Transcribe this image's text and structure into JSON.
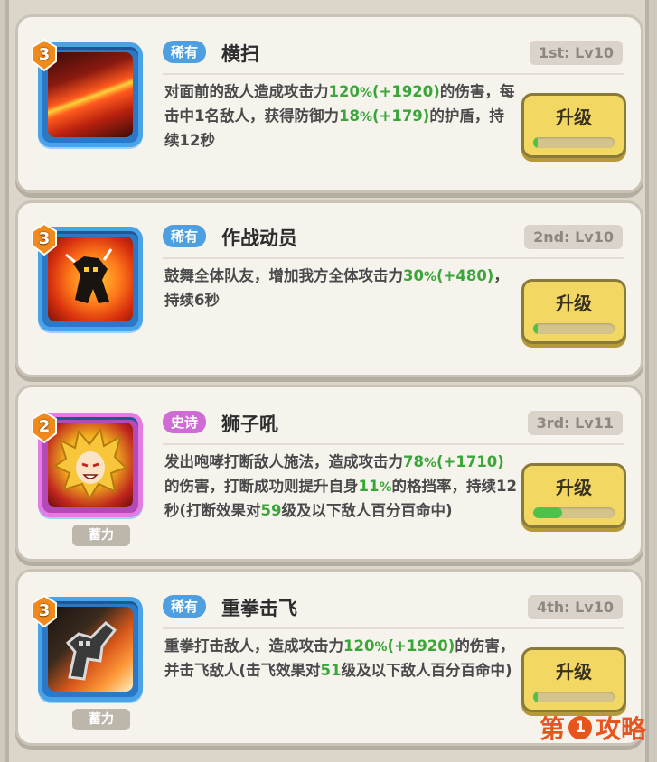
{
  "skills": [
    {
      "stars": "3",
      "rarity": "稀有",
      "name": "横扫",
      "level": "1st: Lv10",
      "desc": [
        "对面前的敌人造成攻击力",
        "120",
        "%",
        "(+1920)",
        "的伤害，每击中1名敌人，获得防御力",
        "18",
        "%",
        "(+179)",
        "的护盾，持续12秒"
      ],
      "upgrade": "升级",
      "progress": 0.05
    },
    {
      "stars": "3",
      "rarity": "稀有",
      "name": "作战动员",
      "level": "2nd: Lv10",
      "desc": [
        "鼓舞全体队友，增加我方全体攻击力",
        "30",
        "%",
        "(+480)",
        "，持续6秒"
      ],
      "upgrade": "升级",
      "progress": 0.05
    },
    {
      "stars": "2",
      "rarity": "史诗",
      "name": "狮子吼",
      "level": "3rd: Lv11",
      "desc": [
        "发出咆哮打断敌人施法，造成攻击力",
        "78",
        "%",
        "(+1710)",
        "的伤害，打断成功则提升自身",
        "11",
        "%",
        "的格挡率，持续12秒(打断效果对",
        "59",
        "级及以下敌人百分百命中)"
      ],
      "upgrade": "升级",
      "progress": 0.35,
      "charge": "蓄力"
    },
    {
      "stars": "3",
      "rarity": "稀有",
      "name": "重拳击飞",
      "level": "4th: Lv10",
      "desc": [
        "重拳打击敌人，造成攻击力",
        "120",
        "%",
        "(+1920)",
        "的伤害，并击飞敌人(击飞效果对",
        "51",
        "级及以下敌人百分百命中)"
      ],
      "upgrade": "升级",
      "progress": 0.05,
      "charge": "蓄力"
    }
  ],
  "watermark": {
    "pre": "第",
    "num": "1",
    "post": "攻略"
  },
  "colors": {
    "rare": "#4d9fe0",
    "epic": "#cf6bd4",
    "upgrade": "#f2d862",
    "green": "#3aa63a"
  }
}
